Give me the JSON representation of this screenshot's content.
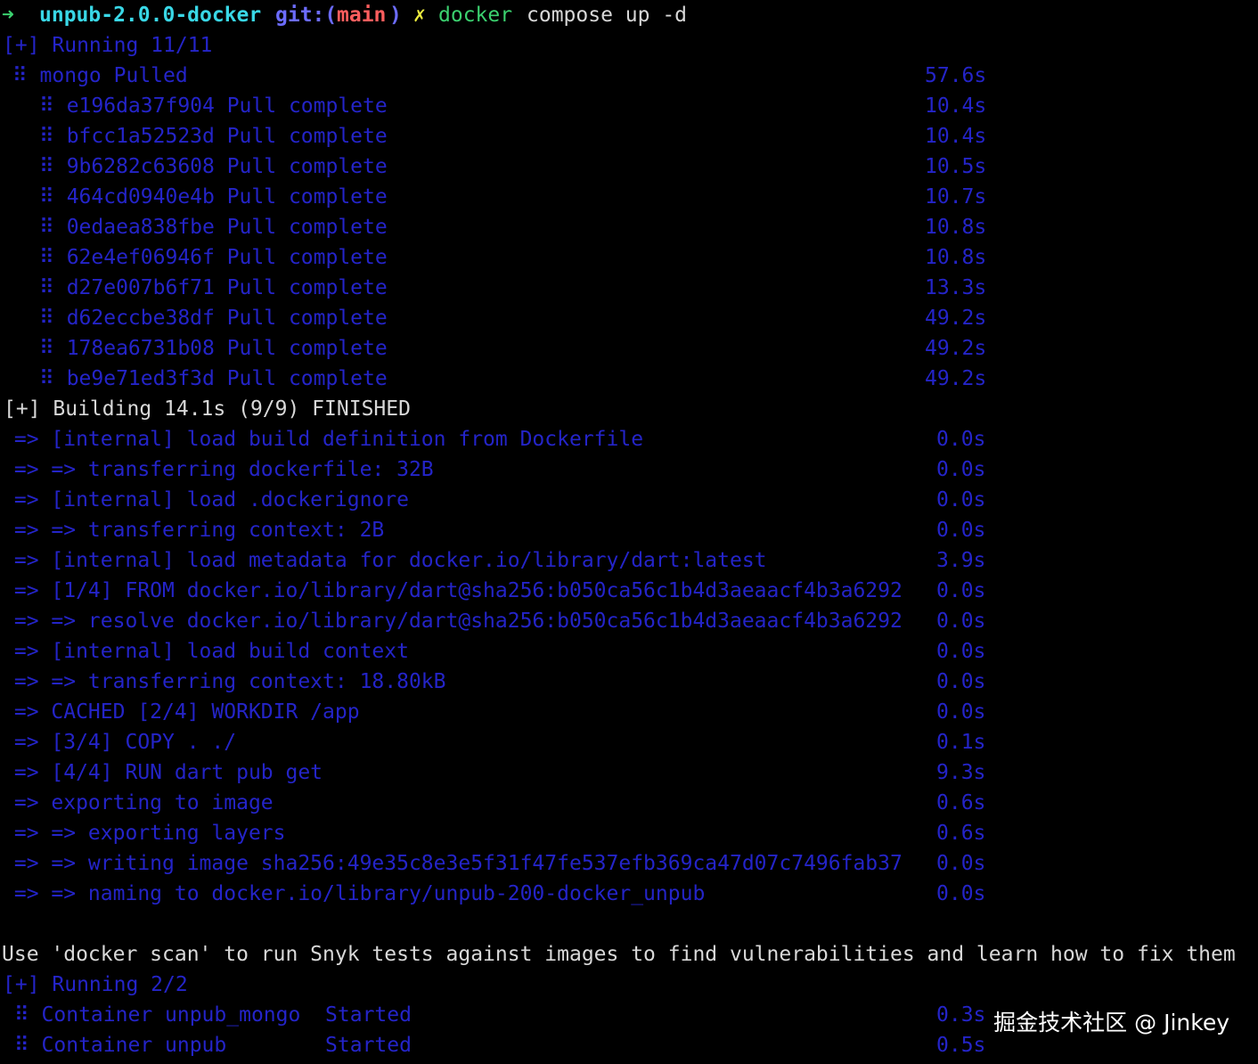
{
  "colors": {
    "background": "#000000",
    "dim_blue": "#2424c8",
    "white": "#d8d8d8",
    "prompt_arrow": "#3bd16f",
    "dir": "#39d7e6",
    "git": "#6c6cff",
    "branch": "#ff5e5e",
    "dirty": "#ecec3f",
    "command": "#3bd16f"
  },
  "prompt": {
    "arrow": "➜",
    "dir": "unpub-2.0.0-docker",
    "git_label": "git:(",
    "branch": "main",
    "git_close": ")",
    "dirty_mark": "✗",
    "command": "docker",
    "args": "compose up -d"
  },
  "running_header": "[+] Running 11/11",
  "mongo": {
    "label": " ⠿ mongo Pulled",
    "time": "57.6s"
  },
  "pull_layers": [
    {
      "text": "⠿ e196da37f904 Pull complete",
      "time": "10.4s"
    },
    {
      "text": "⠿ bfcc1a52523d Pull complete",
      "time": "10.4s"
    },
    {
      "text": "⠿ 9b6282c63608 Pull complete",
      "time": "10.5s"
    },
    {
      "text": "⠿ 464cd0940e4b Pull complete",
      "time": "10.7s"
    },
    {
      "text": "⠿ 0edaea838fbe Pull complete",
      "time": "10.8s"
    },
    {
      "text": "⠿ 62e4ef06946f Pull complete",
      "time": "10.8s"
    },
    {
      "text": "⠿ d27e007b6f71 Pull complete",
      "time": "13.3s"
    },
    {
      "text": "⠿ d62eccbe38df Pull complete",
      "time": "49.2s"
    },
    {
      "text": "⠿ 178ea6731b08 Pull complete",
      "time": "49.2s"
    },
    {
      "text": "⠿ be9e71ed3f3d Pull complete",
      "time": "49.2s"
    }
  ],
  "building_header": "[+] Building 14.1s (9/9) FINISHED",
  "build_steps": [
    {
      "text": " => [internal] load build definition from Dockerfile",
      "time": "0.0s"
    },
    {
      "text": " => => transferring dockerfile: 32B",
      "time": "0.0s"
    },
    {
      "text": " => [internal] load .dockerignore",
      "time": "0.0s"
    },
    {
      "text": " => => transferring context: 2B",
      "time": "0.0s"
    },
    {
      "text": " => [internal] load metadata for docker.io/library/dart:latest",
      "time": "3.9s"
    },
    {
      "text": " => [1/4] FROM docker.io/library/dart@sha256:b050ca56c1b4d3aeaacf4b3a6292",
      "time": "0.0s"
    },
    {
      "text": " => => resolve docker.io/library/dart@sha256:b050ca56c1b4d3aeaacf4b3a6292",
      "time": "0.0s"
    },
    {
      "text": " => [internal] load build context",
      "time": "0.0s"
    },
    {
      "text": " => => transferring context: 18.80kB",
      "time": "0.0s"
    },
    {
      "text": " => CACHED [2/4] WORKDIR /app",
      "time": "0.0s"
    },
    {
      "text": " => [3/4] COPY . ./",
      "time": "0.1s"
    },
    {
      "text": " => [4/4] RUN dart pub get",
      "time": "9.3s"
    },
    {
      "text": " => exporting to image",
      "time": "0.6s"
    },
    {
      "text": " => => exporting layers",
      "time": "0.6s"
    },
    {
      "text": " => => writing image sha256:49e35c8e3e5f31f47fe537efb369ca47d07c7496fab37",
      "time": "0.0s"
    },
    {
      "text": " => => naming to docker.io/library/unpub-200-docker_unpub",
      "time": "0.0s"
    }
  ],
  "snyk_message": "Use 'docker scan' to run Snyk tests against images to find vulnerabilities and learn how to fix them",
  "running2_header": "[+] Running 2/2",
  "containers": [
    {
      "text": " ⠿ Container unpub_mongo  Started",
      "time": "0.3s"
    },
    {
      "text": " ⠿ Container unpub        Started",
      "time": "0.5s"
    }
  ],
  "watermark": "掘金技术社区 @ Jinkey"
}
